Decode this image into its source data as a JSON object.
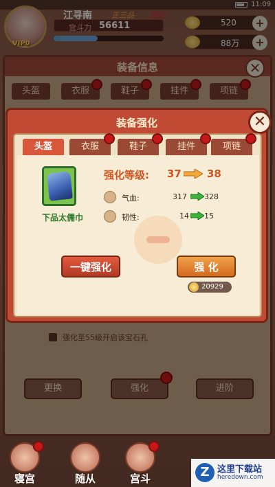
{
  "status_bar": {
    "time": "11:09"
  },
  "hud": {
    "name": "江寻南",
    "rank": "正三品",
    "title": "德妃",
    "power_label": "宫斗力",
    "power": "56611",
    "vip": "VIP0",
    "exp_fraction": 0.4,
    "gold": "520",
    "silver": "88万"
  },
  "back_panel": {
    "title": "装备信息",
    "tabs": [
      "头盔",
      "衣服",
      "鞋子",
      "挂件",
      "项链"
    ],
    "lock_note": "强化至55级开启该宝石孔",
    "buttons": [
      "更换",
      "强化",
      "进阶"
    ]
  },
  "modal": {
    "title": "装备强化",
    "tabs": [
      "头盔",
      "衣服",
      "鞋子",
      "挂件",
      "项链"
    ],
    "active_tab": 0,
    "item_name": "下品太儒巾",
    "level_label": "强化等级:",
    "level_from": "37",
    "level_to": "38",
    "stats": [
      {
        "name": "气血:",
        "from": "317",
        "to": "328"
      },
      {
        "name": "韧性:",
        "from": "14",
        "to": "15"
      }
    ],
    "btn_one_key": "一键强化",
    "btn_enhance": "强 化",
    "cost": "20929"
  },
  "bottom_nav": {
    "items": [
      "寝宫",
      "随从",
      "宫斗"
    ]
  },
  "watermark": {
    "logo": "Z",
    "text": "这里下载站",
    "url": "heredown.com"
  },
  "colors": {
    "modal_frame": "#c04a33",
    "panel_bg": "#f0e2c6",
    "accent_orange": "#d2541f",
    "item_green": "#2f7a2a",
    "badge_red": "#c61818"
  }
}
